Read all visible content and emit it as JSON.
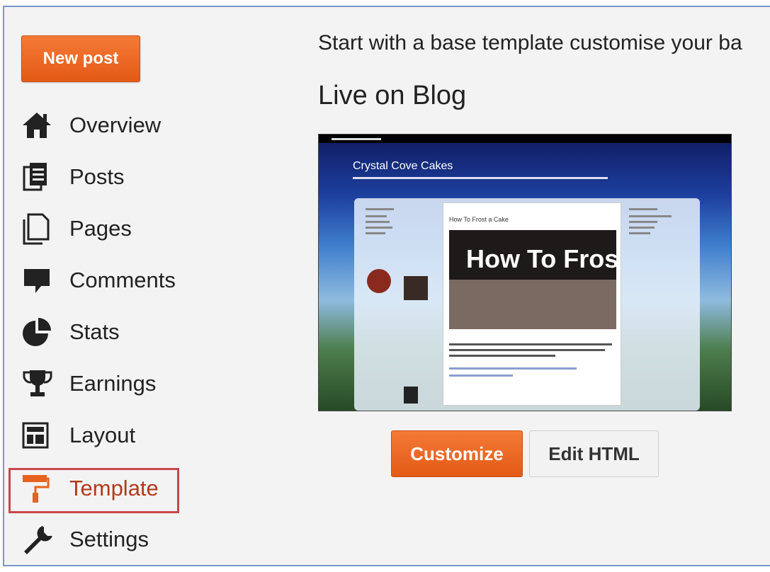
{
  "sidebar": {
    "new_post_label": "New post",
    "items": [
      {
        "label": "Overview",
        "icon": "home-icon"
      },
      {
        "label": "Posts",
        "icon": "posts-icon"
      },
      {
        "label": "Pages",
        "icon": "pages-icon"
      },
      {
        "label": "Comments",
        "icon": "comment-icon"
      },
      {
        "label": "Stats",
        "icon": "pie-chart-icon"
      },
      {
        "label": "Earnings",
        "icon": "trophy-icon"
      },
      {
        "label": "Layout",
        "icon": "layout-icon"
      },
      {
        "label": "Template",
        "icon": "paint-roller-icon",
        "selected": true
      },
      {
        "label": "Settings",
        "icon": "wrench-icon"
      }
    ]
  },
  "main": {
    "intro_text": "Start with a base template customise your ba",
    "live_title": "Live on Blog",
    "preview": {
      "blog_title": "Crystal Cove Cakes",
      "post_title": "How To Frost a Cake",
      "photo_text": "How To Fros"
    },
    "customize_label": "Customize",
    "edit_html_label": "Edit HTML"
  },
  "colors": {
    "accent": "#e8621f",
    "selected_text": "#b33a1b",
    "selected_border": "#c9474b"
  }
}
